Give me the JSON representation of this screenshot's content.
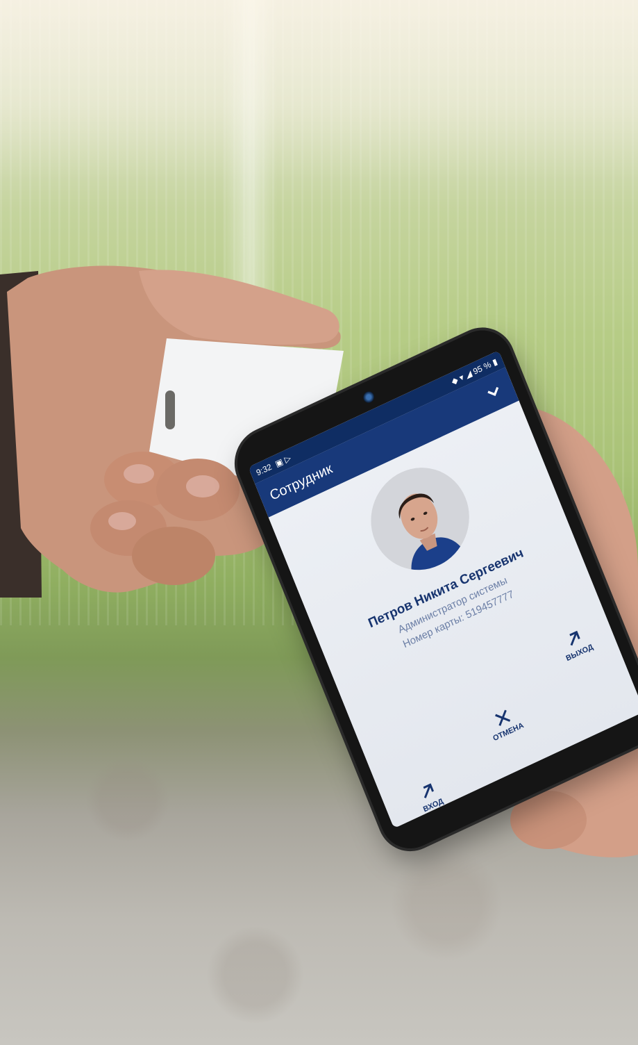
{
  "status_bar": {
    "time": "9:32",
    "icons": "▣ ▷",
    "battery": "95 %"
  },
  "app_bar": {
    "title": "Сотрудник",
    "confirm_icon": "check-icon"
  },
  "employee": {
    "name": "Петров Никита Сергеевич",
    "role": "Администратор системы",
    "card_number_label": "Номер карты:",
    "card_number": "519457777"
  },
  "actions": {
    "exit": "ВЫХОД",
    "cancel": "ОТМЕНА",
    "enter": "ВХОД"
  },
  "colors": {
    "app_bar": "#18397a",
    "status_bar": "#0f2d63",
    "text_primary": "#17346f",
    "text_secondary": "#6c7fa6"
  }
}
